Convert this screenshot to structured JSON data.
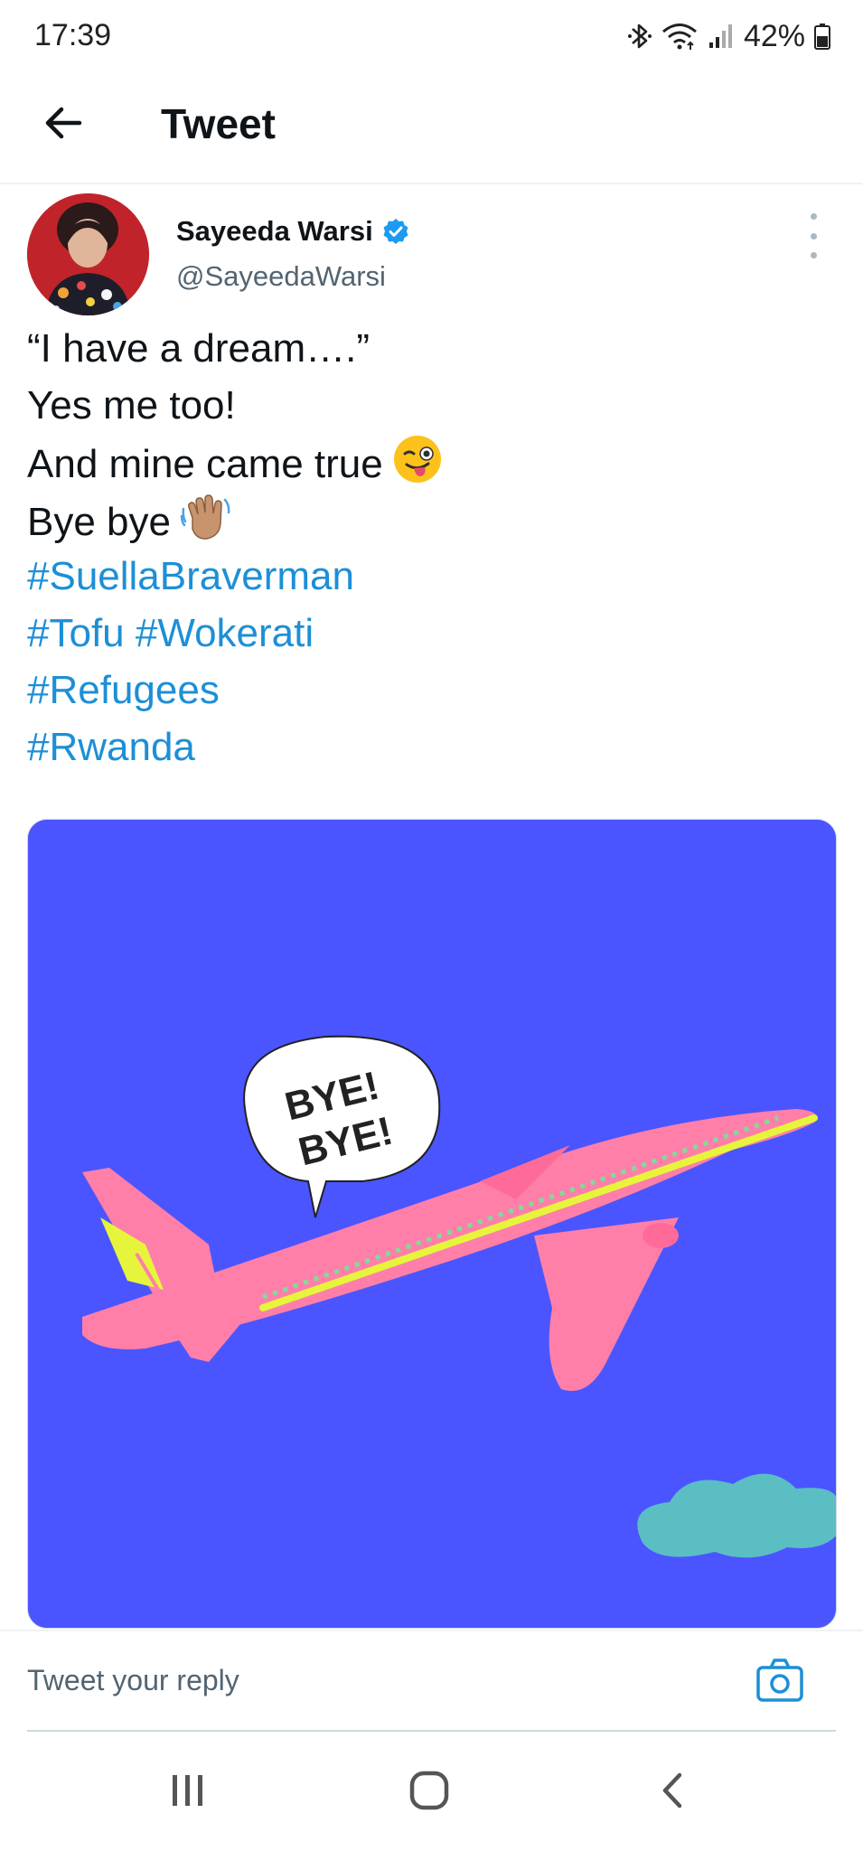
{
  "status_bar": {
    "time": "17:39",
    "battery": "42%",
    "icons": [
      "bluetooth-icon",
      "wifi-icon",
      "signal-icon",
      "battery-icon"
    ]
  },
  "header": {
    "title": "Tweet",
    "back_icon": "arrow-left-icon"
  },
  "tweet": {
    "author_name": "Sayeeda Warsi",
    "author_handle": "@SayeedaWarsi",
    "verified": true,
    "lines": [
      {
        "text": "“I have a dream….”",
        "type": "text"
      },
      {
        "text": "Yes me too!",
        "type": "text"
      },
      {
        "text": "And mine came true",
        "type": "text",
        "emoji": "winking-tongue-emoji"
      },
      {
        "text": "Bye bye",
        "type": "text",
        "emoji": "waving-hand-emoji"
      },
      {
        "text": "#SuellaBraverman",
        "type": "hashtag"
      },
      {
        "text": "#Tofu #Wokerati",
        "type": "hashtag"
      },
      {
        "text": "#Refugees",
        "type": "hashtag"
      },
      {
        "text": "#Rwanda",
        "type": "hashtag"
      }
    ],
    "image": {
      "speech_bubble_line1": "BYE!",
      "speech_bubble_line2": "BYE!",
      "background_color": "#4a55ff",
      "plane_color": "#ff7fa8",
      "stripe_color": "#e6f53c",
      "cloud_color": "#5bbec3"
    }
  },
  "reply": {
    "placeholder": "Tweet your reply",
    "camera_icon": "camera-icon"
  },
  "nav": {
    "icons": [
      "recent-apps-icon",
      "home-icon",
      "back-icon"
    ]
  },
  "colors": {
    "link": "#1d8fd6",
    "verified": "#1d9bf0",
    "text": "#0f1419",
    "muted": "#536471"
  }
}
